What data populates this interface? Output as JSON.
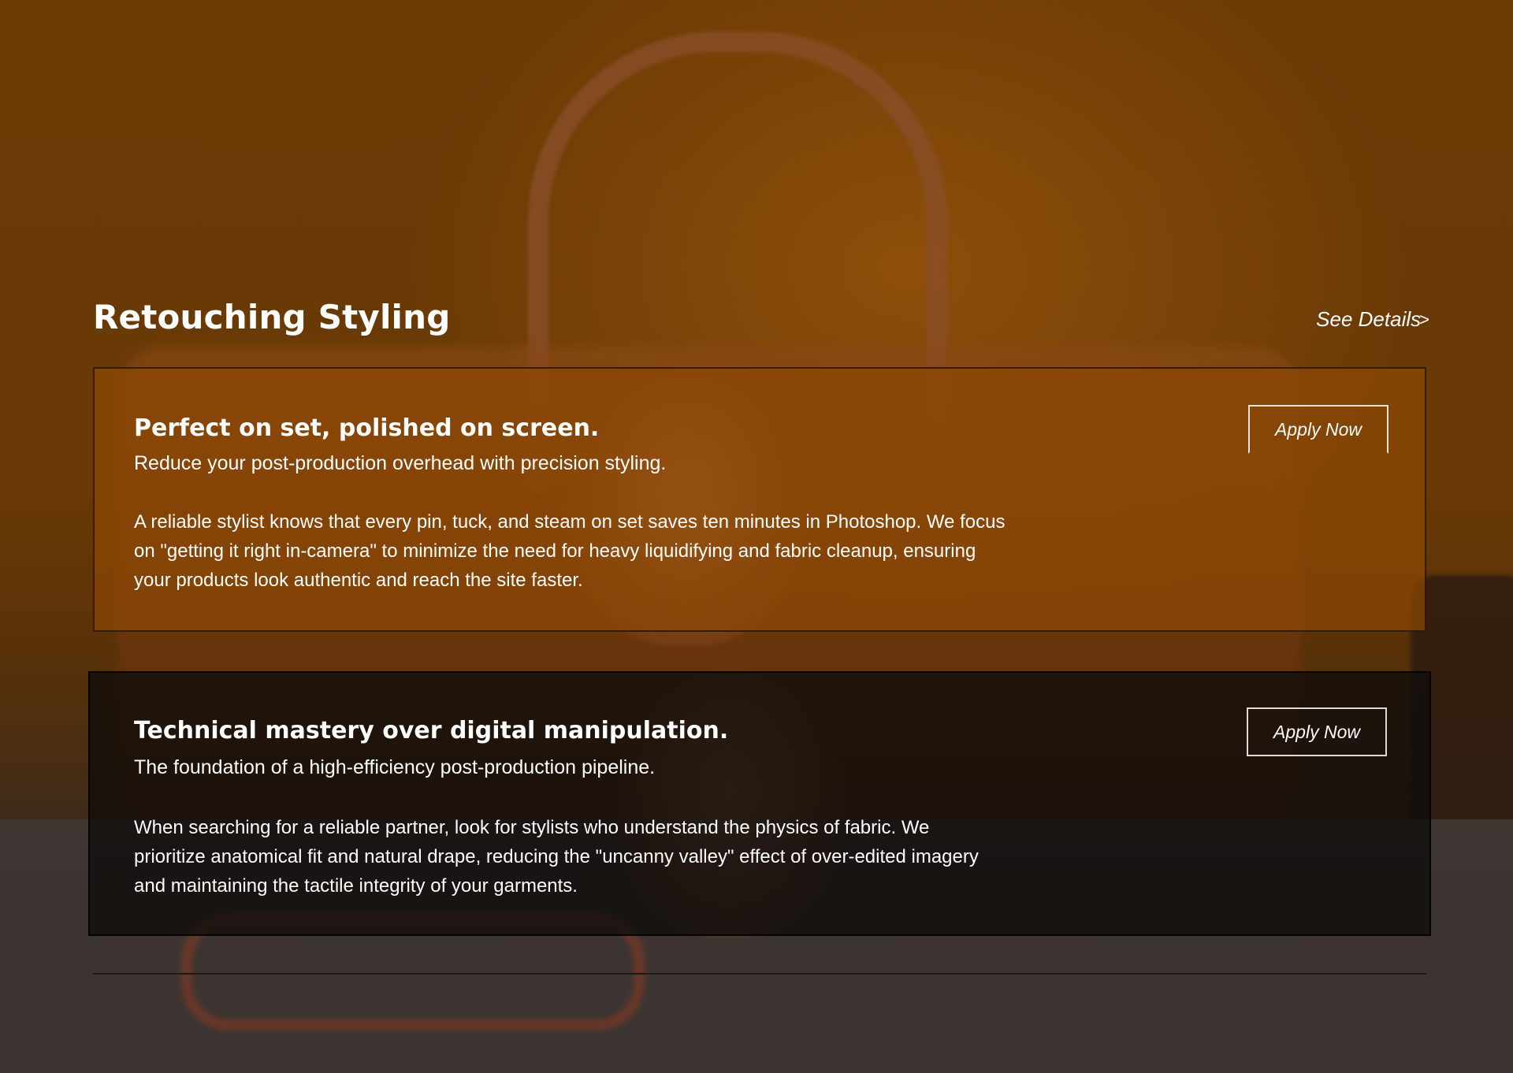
{
  "section": {
    "title": "Retouching Styling",
    "see_details_label": "See Details",
    "see_details_icon": "chevron-right-icon"
  },
  "cards": [
    {
      "heading": "Perfect on set, polished on screen.",
      "subheading": "Reduce your post-production overhead with precision styling.",
      "body": "A reliable stylist knows that every pin, tuck, and steam on set saves ten minutes in Photoshop. We focus on \"getting it right in-camera\" to minimize the need for heavy liquidifying and fabric cleanup, ensuring your products look authentic and reach the site faster.",
      "button_label": "Apply Now",
      "tint": "#8c4804"
    },
    {
      "heading": "Technical mastery over digital manipulation.",
      "subheading": "The foundation of a high-efficiency post-production pipeline.",
      "body": "When searching for a reliable partner, look for stylists who understand the physics of fabric. We prioritize anatomical fit and natural drape, reducing the \"uncanny valley\" effect of over-edited imagery and maintaining the tactile integrity of your garments.",
      "button_label": "Apply Now",
      "tint": "#0e0c0a"
    }
  ],
  "colors": {
    "background": "#6b3a05",
    "text": "#ffffff",
    "divider": "#1e1a18"
  }
}
